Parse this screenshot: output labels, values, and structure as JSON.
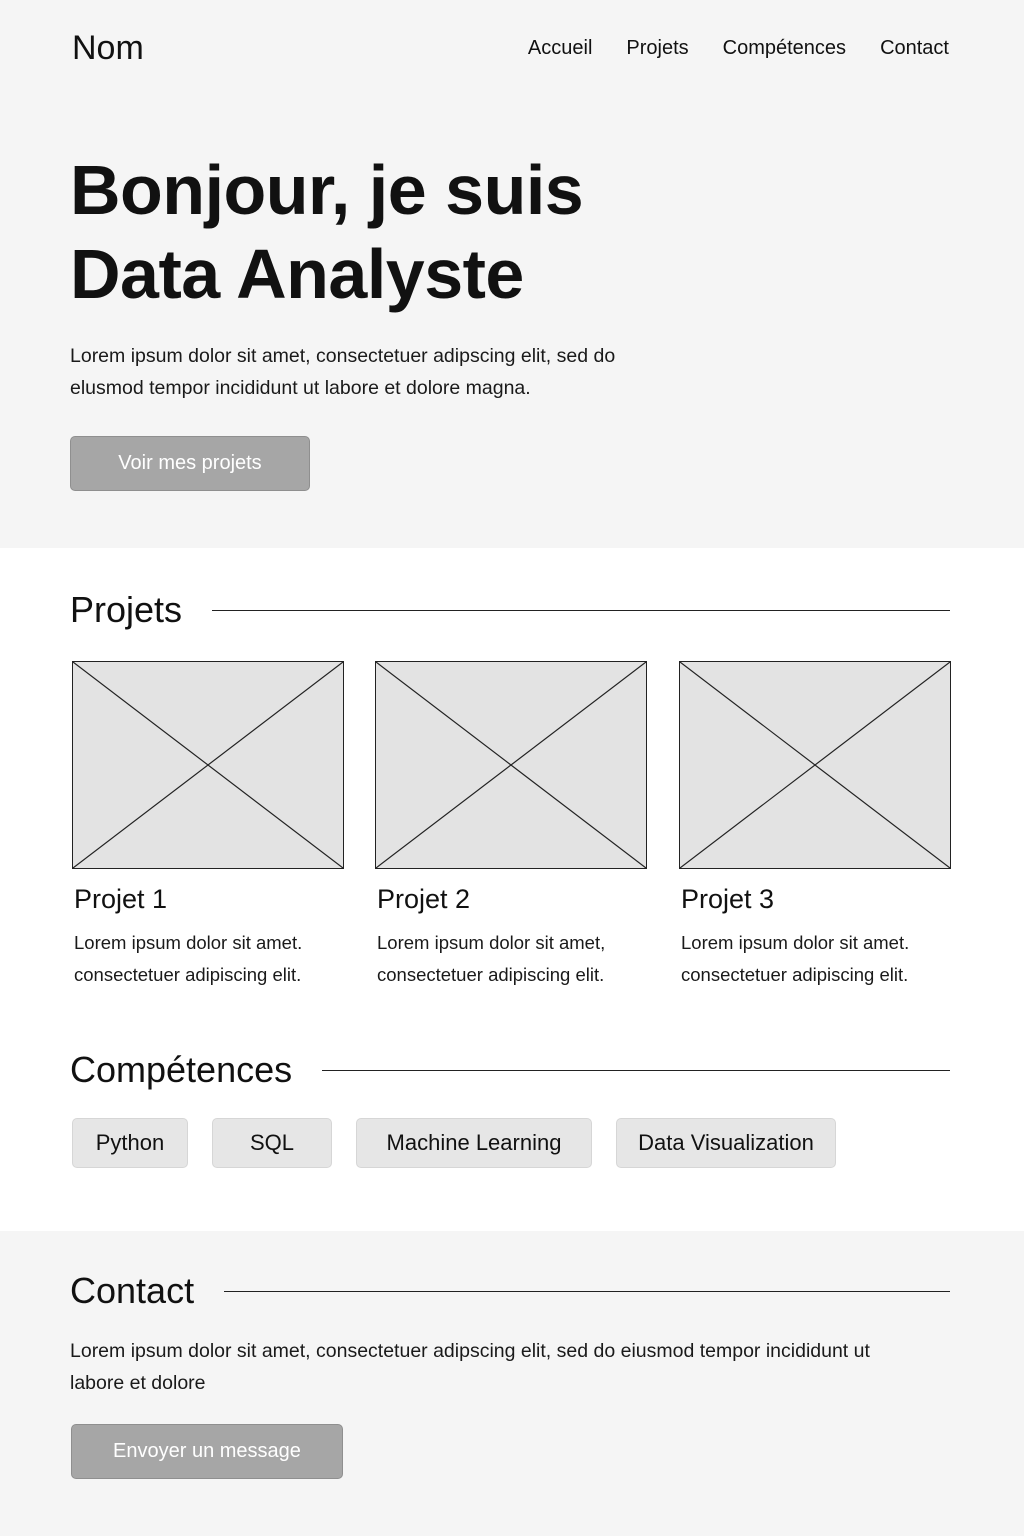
{
  "header": {
    "logo": "Nom",
    "nav": [
      "Accueil",
      "Projets",
      "Compétences",
      "Contact"
    ]
  },
  "hero": {
    "title_line1": "Bonjour, je suis",
    "title_line2": "Data Analyste",
    "description": "Lorem ipsum dolor sit amet, consectetuer adipscing elit, sed do elusmod tempor incididunt ut labore et dolore magna.",
    "cta_label": "Voir mes projets"
  },
  "projects": {
    "heading": "Projets",
    "items": [
      {
        "title": "Projet 1",
        "description": "Lorem ipsum dolor sit amet. consectetuer adipiscing elit."
      },
      {
        "title": "Projet 2",
        "description": "Lorem ipsum dolor sit amet, consectetuer adipiscing elit."
      },
      {
        "title": "Projet 3",
        "description": "Lorem ipsum dolor sit amet. consectetuer adipiscing elit."
      }
    ]
  },
  "skills": {
    "heading": "Compétences",
    "items": [
      "Python",
      "SQL",
      "Machine Learning",
      "Data Visualization"
    ]
  },
  "contact": {
    "heading": "Contact",
    "description": "Lorem ipsum dolor sit amet, consectetuer adipscing elit, sed do eiusmod tempor incididunt ut labore et dolore",
    "cta_label": "Envoyer un message"
  },
  "colors": {
    "hero_background": "#f5f5f5",
    "button": "#a6a6a6",
    "placeholder": "#e3e3e3",
    "chip": "#e6e6e6"
  },
  "icons": {
    "project_image": "image-placeholder-icon"
  }
}
